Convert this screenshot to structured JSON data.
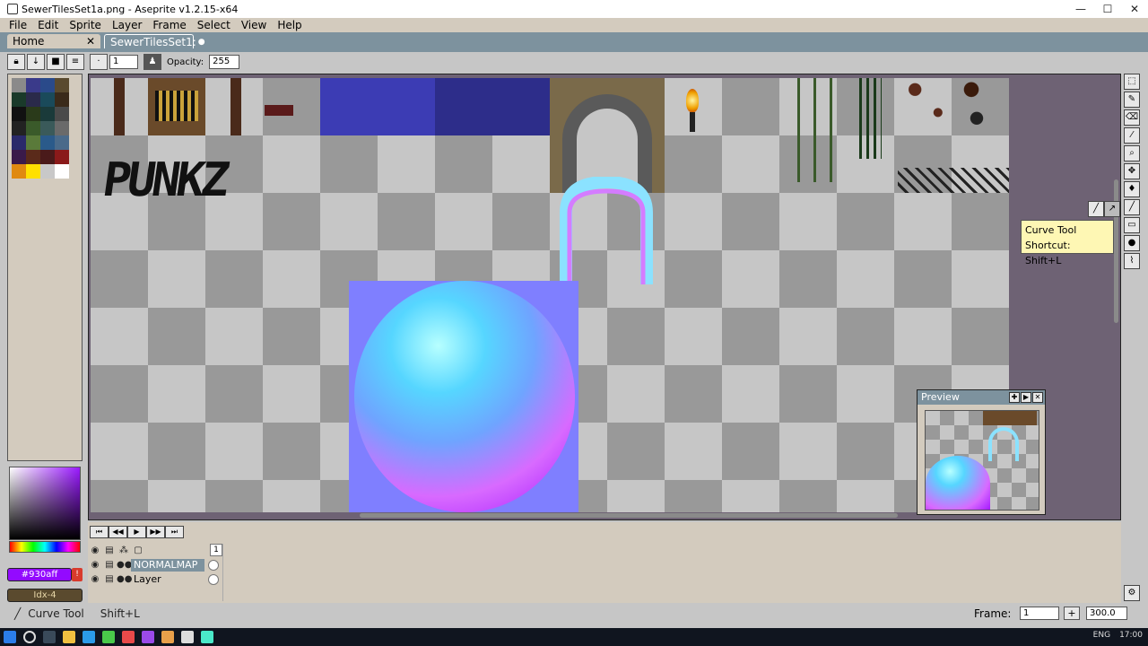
{
  "window": {
    "title": "SewerTilesSet1a.png - Aseprite v1.2.15-x64",
    "minimize": "—",
    "maximize": "☐",
    "close": "✕"
  },
  "menu": [
    "File",
    "Edit",
    "Sprite",
    "Layer",
    "Frame",
    "Select",
    "View",
    "Help"
  ],
  "tabs": {
    "home": "Home",
    "home_close": "✕",
    "active": "SewerTilesSet1:",
    "active_dot": "●"
  },
  "context_bar": {
    "brush_size": "1",
    "opacity_label": "Opacity:",
    "opacity_value": "255"
  },
  "palette": {
    "colors": [
      "#8a8a8a",
      "#3a3a8a",
      "#2a4a8a",
      "#5a4a2e",
      "#1a3a2a",
      "#2a2a4a",
      "#1a4a5a",
      "#3a2a1a",
      "#111111",
      "#2a3a1a",
      "#1a3a3a",
      "#4a4a4a",
      "#222222",
      "#3a5a2a",
      "#3a5a5a",
      "#6a6a6a",
      "#2a2a6a",
      "#5a7a3a",
      "#2a5a8a",
      "#4a6a8a",
      "#3a1a4a",
      "#5a2a1a",
      "#4a1a1a",
      "#8a1a1a",
      "#e08a10",
      "#ffe000",
      "#c8c8c8",
      "#ffffff"
    ],
    "selected_hex": "#930aff",
    "index_label": "Idx-4"
  },
  "tooltip": {
    "name": "Curve Tool",
    "shortcut": "Shortcut: Shift+L"
  },
  "preview": {
    "title": "Preview"
  },
  "timeline": {
    "frame_number": "1",
    "layers": [
      "NORMALMAP",
      "Layer"
    ]
  },
  "status": {
    "tool": "Curve Tool",
    "shortcut": "Shift+L",
    "frame_label": "Frame:",
    "frame_value": "1",
    "zoom_plus": "+",
    "zoom_value": "300.0"
  },
  "sprite": {
    "graffiti": "PUNKZ"
  },
  "taskbar": {
    "lang": "ENG",
    "time": "17:00"
  }
}
